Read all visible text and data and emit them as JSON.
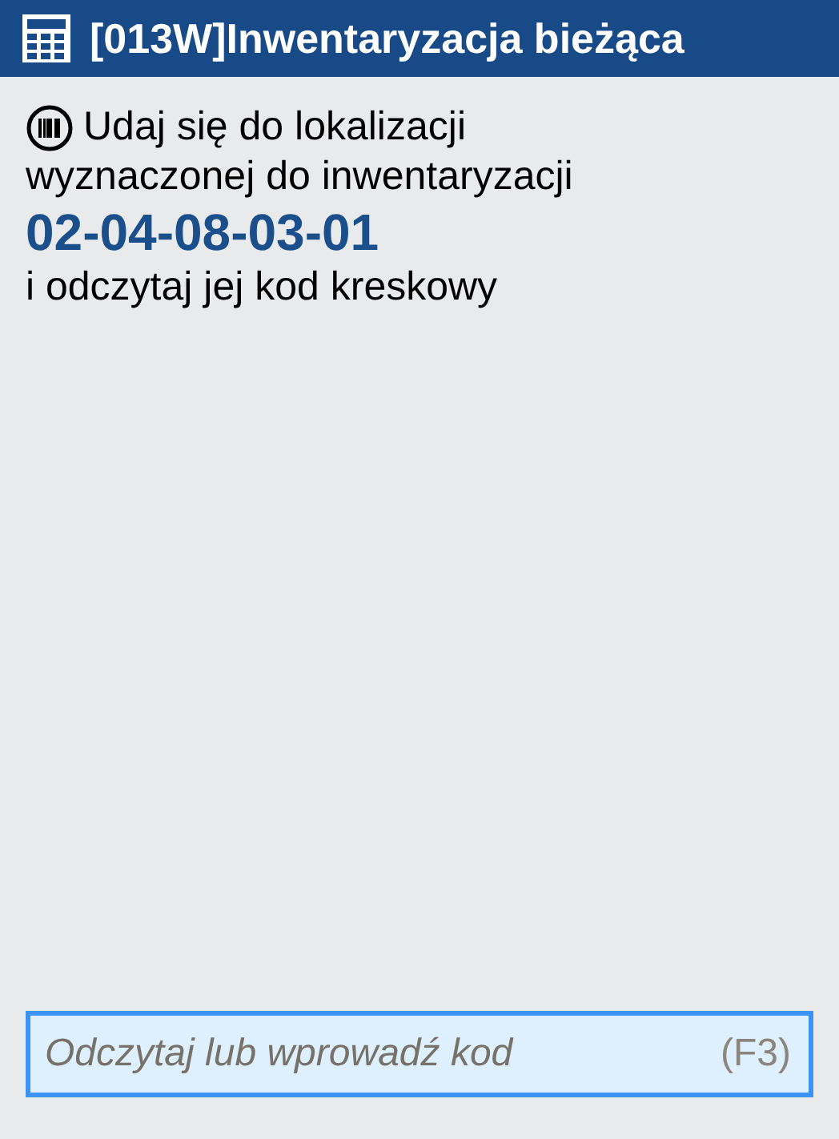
{
  "window": {
    "title": "[013W]Inwentaryzacja bieżąca"
  },
  "instruction": {
    "line_1": "Udaj się do lokalizacji",
    "line_2": "wyznaczonej do inwentaryzacji",
    "location_code": "02-04-08-03-01",
    "line_3": "i odczytaj jej kod kreskowy"
  },
  "code_field": {
    "placeholder": "Odczytaj lub wprowadź kod",
    "shortcut": "(F3)",
    "focused": true
  }
}
